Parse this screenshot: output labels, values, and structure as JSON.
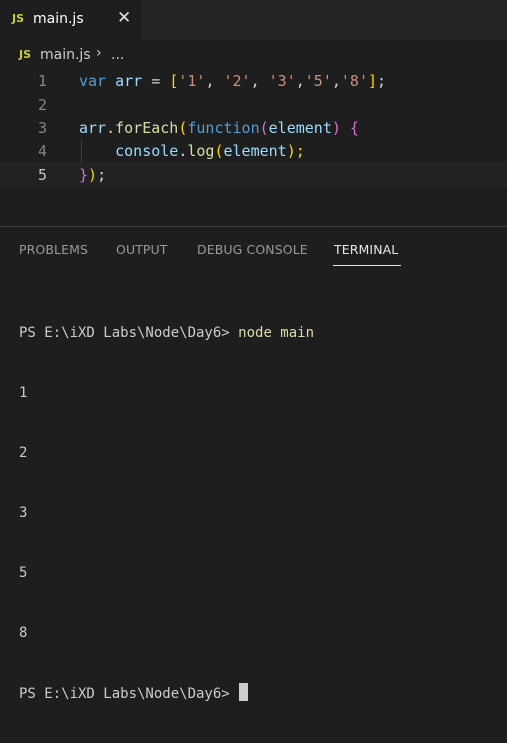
{
  "tab": {
    "badge": "JS",
    "filename": "main.js",
    "close": "✕"
  },
  "breadcrumb": {
    "badge": "JS",
    "file": "main.js",
    "separator": "›",
    "more": "..."
  },
  "editor": {
    "lines": [
      {
        "number": "1",
        "tokens": [
          "var",
          " ",
          "arr",
          " = ",
          "[",
          "'1'",
          ", ",
          "'2'",
          ", ",
          "'3'",
          ",",
          "'5'",
          ",",
          "'8'",
          "]",
          ";"
        ]
      },
      {
        "number": "2"
      },
      {
        "number": "3",
        "tokens": [
          "arr",
          ".",
          "forEach",
          "(",
          "function",
          "(",
          "element",
          ") ",
          "{"
        ]
      },
      {
        "number": "4",
        "tokens": [
          "console",
          ".",
          "log",
          "(",
          "element",
          ");"
        ]
      },
      {
        "number": "5",
        "tokens": [
          "}",
          ")",
          ";"
        ]
      }
    ]
  },
  "panel": {
    "tabs": [
      "PROBLEMS",
      "OUTPUT",
      "DEBUG CONSOLE",
      "TERMINAL"
    ],
    "active_tab": "TERMINAL"
  },
  "terminal": {
    "prompt": "PS E:\\iXD Labs\\Node\\Day6> ",
    "command": "node main",
    "output": [
      "1",
      "2",
      "3",
      "5",
      "8"
    ]
  },
  "colors": {
    "keyword": "#569cd6",
    "variable": "#9cdcfe",
    "string": "#ce9178",
    "function": "#dcdcaa",
    "bracket1": "#ffd700",
    "bracket2": "#da70d6",
    "js_badge": "#cbcb41"
  }
}
